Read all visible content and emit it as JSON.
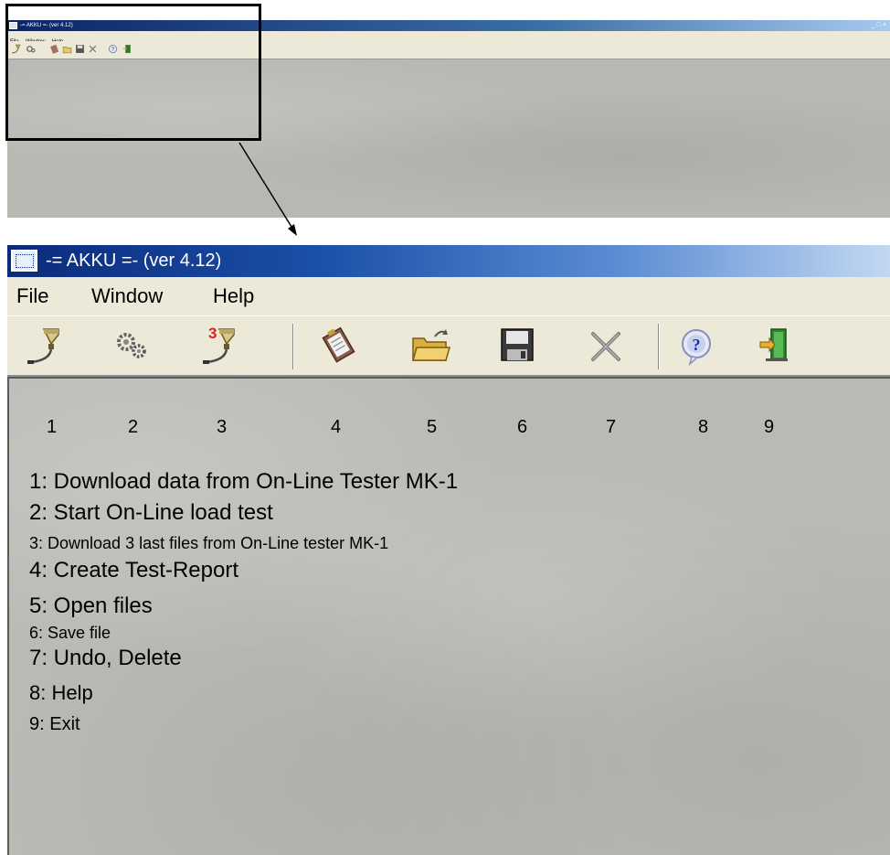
{
  "thumbnail": {
    "title": "-= AKKU =- (ver 4.12)",
    "menu": [
      "File",
      "Window",
      "Help"
    ],
    "window_controls": "_ □ ×"
  },
  "window": {
    "title": "-= AKKU =- (ver 4.12)",
    "menu": {
      "file": "File",
      "window": "Window",
      "help": "Help"
    },
    "toolbar": [
      {
        "icon": "download-tester-icon",
        "number": "1"
      },
      {
        "icon": "gears-icon",
        "number": "2"
      },
      {
        "icon": "download-3-icon",
        "number": "3",
        "badge": "3"
      },
      {
        "icon": "clipboard-report-icon",
        "number": "4"
      },
      {
        "icon": "open-folder-icon",
        "number": "5"
      },
      {
        "icon": "floppy-save-icon",
        "number": "6"
      },
      {
        "icon": "delete-x-icon",
        "number": "7"
      },
      {
        "icon": "help-icon",
        "number": "8"
      },
      {
        "icon": "exit-door-icon",
        "number": "9"
      }
    ],
    "legend": [
      "1: Download data from On-Line Tester MK-1",
      "2: Start On-Line load test",
      "3: Download 3 last files from On-Line tester MK-1",
      "4: Create Test-Report",
      "5: Open files",
      "6: Save file",
      "7: Undo, Delete",
      "8: Help",
      "9: Exit"
    ]
  },
  "colors": {
    "titlebar_start": "#0b2a7a",
    "titlebar_end": "#c3d8f1",
    "chrome": "#ece9d8",
    "canvas": "#b9bab4",
    "badge_red": "#e02020"
  }
}
